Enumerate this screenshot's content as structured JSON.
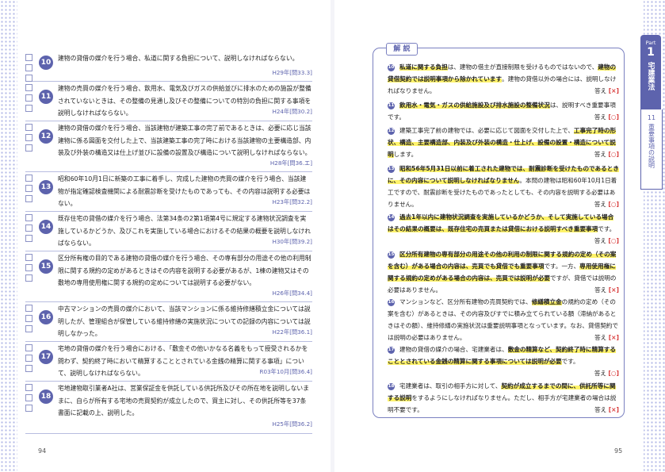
{
  "left": {
    "page_number": "94",
    "questions": [
      {
        "num": "10",
        "text": "建物の貸借の媒介を行う場合、私道に関する負担について、説明しなければならない。",
        "source": "H29年[問33.3]"
      },
      {
        "num": "11",
        "text": "建物の売買の媒介を行う場合、飲用水、電気及びガスの供給並びに排水のための施設が整備されていないときは、その整備の見通し及びその整備についての特別の負担に関する事項を説明しなければならない。",
        "source": "H24年[問30.2]"
      },
      {
        "num": "12",
        "text": "建物の貸借の媒介を行う場合、当該建物が建築工事の完了前であるときは、必要に応じ当該建物に係る図面を交付した上で、当該建築工事の完了時における当該建物の主要構造部、内装及び外装の構造又は仕上げ並びに設備の設置及び構造について説明しなければならない。",
        "source": "H28年[問36.エ]"
      },
      {
        "num": "13",
        "text": "昭和60年10月1日に新築の工事に着手し、完成した建物の売買の媒介を行う場合、当該建物が指定確認検査機関による耐震診断を受けたものであっても、その内容は説明する必要はない。",
        "source": "H23年[問32.2]"
      },
      {
        "num": "14",
        "text": "既存住宅の貸借の媒介を行う場合、法第34条の2第1項第4号に規定する建物状況調査を実施しているかどうか、及びこれを実施している場合におけるその結果の概要を説明しなければならない。",
        "source": "H30年[問39.2]"
      },
      {
        "num": "15",
        "text": "区分所有権の目的である建物の貸借の媒介を行う場合、その専有部分の用途その他の利用制限に関する規約の定めがあるときはその内容を説明する必要があるが、1棟の建物又はその敷地の専用使用権に関する規約の定めについては説明する必要がない。",
        "source": "H26年[問34.4]"
      },
      {
        "num": "16",
        "text": "中古マンションの売買の媒介において、当該マンションに係る維持修繕積立金については説明したが、管理組合が保管している維持修繕の実施状況についての記録の内容については説明しなかった。",
        "source": "H22年[問36.1]"
      },
      {
        "num": "17",
        "text": "宅地の貸借の媒介を行う場合における、「敷金その他いかなる名義をもって授受されるかを問わず、契約終了時において精算することとされている金銭の精算に関する事項」について、説明しなければならない。",
        "source": "R03年10月[問36.4]"
      },
      {
        "num": "18",
        "text": "宅地建物取引業者A社は、営業保証金を供託している供託所及びその所在地を説明しないままに、自らが所有する宅地の売買契約が成立したので、買主に対し、その供託所等を37条書面に記載の上、説明した。",
        "source": "H25年[問36.2]"
      }
    ]
  },
  "right": {
    "page_number": "95",
    "box_title": "解 説",
    "answer_label": "答え",
    "explanations": [
      {
        "num": "10",
        "highlight": "私道に関する負担",
        "text_a": "は、建物の借主が直接制限を受けるものではないので、",
        "highlight2": "建物の貸借契約では説明事項から除かれています",
        "text_b": "。建物の貸借以外の場合には、説明しなければなりません。",
        "mark": "[×]"
      },
      {
        "num": "11",
        "highlight": "飲用水・電気・ガスの供給施設及び排水施設の整備状況",
        "text_a": "は、説明すべき重要事項です。",
        "highlight2": "",
        "text_b": "",
        "mark": "[○]"
      },
      {
        "num": "12",
        "highlight": "",
        "text_a": "建築工事完了前の建物では、必要に応じて図面を交付した上で、",
        "highlight2": "工事完了時の形状、構造、主要構造部、内装及び外装の構造・仕上げ、設備の設置・構造について説明",
        "text_b": "します。",
        "mark": "[○]"
      },
      {
        "num": "13",
        "highlight": "昭和56年5月31日以前に着工された建物では、耐震診断を受けたものであるときに、その内容について説明しなければなりません",
        "text_a": "。本問の建物は昭和60年10月1日着工ですので、耐震診断を受けたものであったとしても、その内容を説明する必要はありません。",
        "highlight2": "",
        "text_b": "",
        "mark": "[○]"
      },
      {
        "num": "14",
        "highlight": "過去1年以内に建物状況調査を実施しているかどうか、そして実施している場合はその結果の概要は、既存住宅の売買または貸借における説明すべき重要事項",
        "text_a": "です。",
        "highlight2": "",
        "text_b": "",
        "mark": "[○]"
      },
      {
        "num": "15",
        "highlight": "区分所有建物の専有部分の用途その他の利用の制限に関する規約の定め（その案を含む）がある場合の内容は、売買でも貸借でも重要事項",
        "text_a": "です。一方、",
        "highlight2": "専用使用権に関する規約の定めがある場合の内容は、売買では説明が必要",
        "text_b": "ですが、貸借では説明の必要はありません。",
        "mark": "[×]"
      },
      {
        "num": "16",
        "highlight": "",
        "text_a": "マンションなど、区分所有建物の売買契約では、",
        "highlight2": "修繕積立金",
        "text_b": "の規約の定め（その案を含む）があるときは、その内容及びすでに積み立てられている額（滞納があるときはその額）、維持修繕の実施状況は重要説明事項となっています。なお、貸借契約では説明の必要はありません。",
        "mark": "[×]"
      },
      {
        "num": "17",
        "highlight": "",
        "text_a": "建物の貸借の媒介の場合、宅建業者は、",
        "highlight2": "敷金の精算など、契約終了時に精算することとされている金銭の精算に関する事項については説明が必要",
        "text_b": "です。",
        "mark": "[○]"
      },
      {
        "num": "18",
        "highlight": "",
        "text_a": "宅建業者は、取引の相手方に対して、",
        "highlight2": "契約が成立するまでの間に、供託所等に関する説明",
        "text_b": "をするようにしなければなりません。ただし、相手方が宅建業者の場合は説明不要です。",
        "mark": "[×]"
      }
    ]
  },
  "tab": {
    "part_label": "Part",
    "part_number": "1",
    "part_title": "宅建業法",
    "chapter_number": "11",
    "chapter_title": "重要事項の説明"
  },
  "colors": {
    "accent": "#5d63ad",
    "highlight": "#fff36a",
    "mark": "#d83a3a"
  }
}
